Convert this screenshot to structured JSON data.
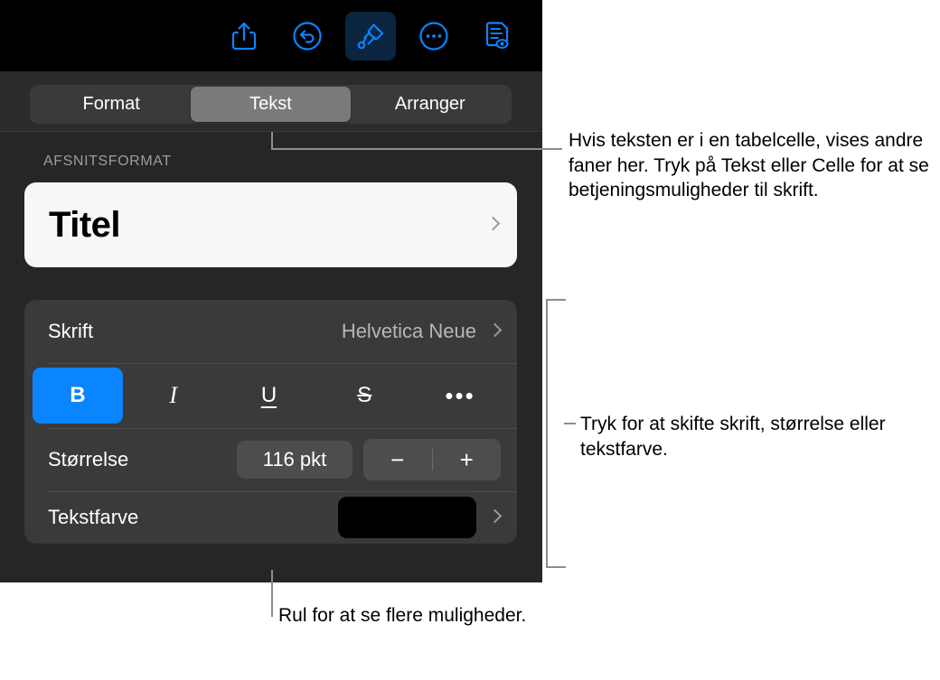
{
  "toolbar": {
    "buttons": [
      {
        "name": "share-icon",
        "label": "Del"
      },
      {
        "name": "undo-icon",
        "label": "Fortryd"
      },
      {
        "name": "format-brush-icon",
        "label": "Format",
        "active": true
      },
      {
        "name": "more-icon",
        "label": "Mere"
      },
      {
        "name": "document-preview-icon",
        "label": "Dokumentoversigt"
      }
    ]
  },
  "tabs": {
    "items": [
      {
        "label": "Format",
        "selected": false
      },
      {
        "label": "Tekst",
        "selected": true
      },
      {
        "label": "Arranger",
        "selected": false
      }
    ]
  },
  "paragraph": {
    "section_label": "AFSNITSFORMAT",
    "style_name": "Titel",
    "chevron": "chevron-right-icon"
  },
  "font": {
    "label": "Skrift",
    "value": "Helvetica Neue",
    "chevron": "chevron-right-icon",
    "styles": [
      {
        "name": "bold-button",
        "glyph": "B",
        "class": "bold-g",
        "active": true
      },
      {
        "name": "italic-button",
        "glyph": "I",
        "class": "ital-g",
        "active": false
      },
      {
        "name": "underline-button",
        "glyph": "U",
        "class": "und-g",
        "active": false
      },
      {
        "name": "strikethrough-button",
        "glyph": "S",
        "class": "strike-g",
        "active": false
      },
      {
        "name": "more-styles-button",
        "glyph": "•••",
        "class": "dots-g",
        "active": false
      }
    ]
  },
  "size": {
    "label": "Størrelse",
    "value": "116 pkt",
    "decrement": "−",
    "increment": "+"
  },
  "text_color": {
    "label": "Tekstfarve",
    "swatch_color": "#000000",
    "chevron": "chevron-right-icon"
  },
  "callouts": {
    "tabs_note": "Hvis teksten er i en tabelcelle, vises andre faner her. Tryk på Tekst eller Celle for at se betjeningsmuligheder til skrift.",
    "font_note": "Tryk for at skifte skrift, størrelse eller tekstfarve.",
    "scroll_note": "Rul for at se flere muligheder."
  },
  "colors": {
    "accent": "#0a84ff",
    "toolbar_bg": "#000000",
    "panel_bg": "#262626",
    "card_bg": "#3a3a3a",
    "callout_line": "#8c8c8c"
  }
}
